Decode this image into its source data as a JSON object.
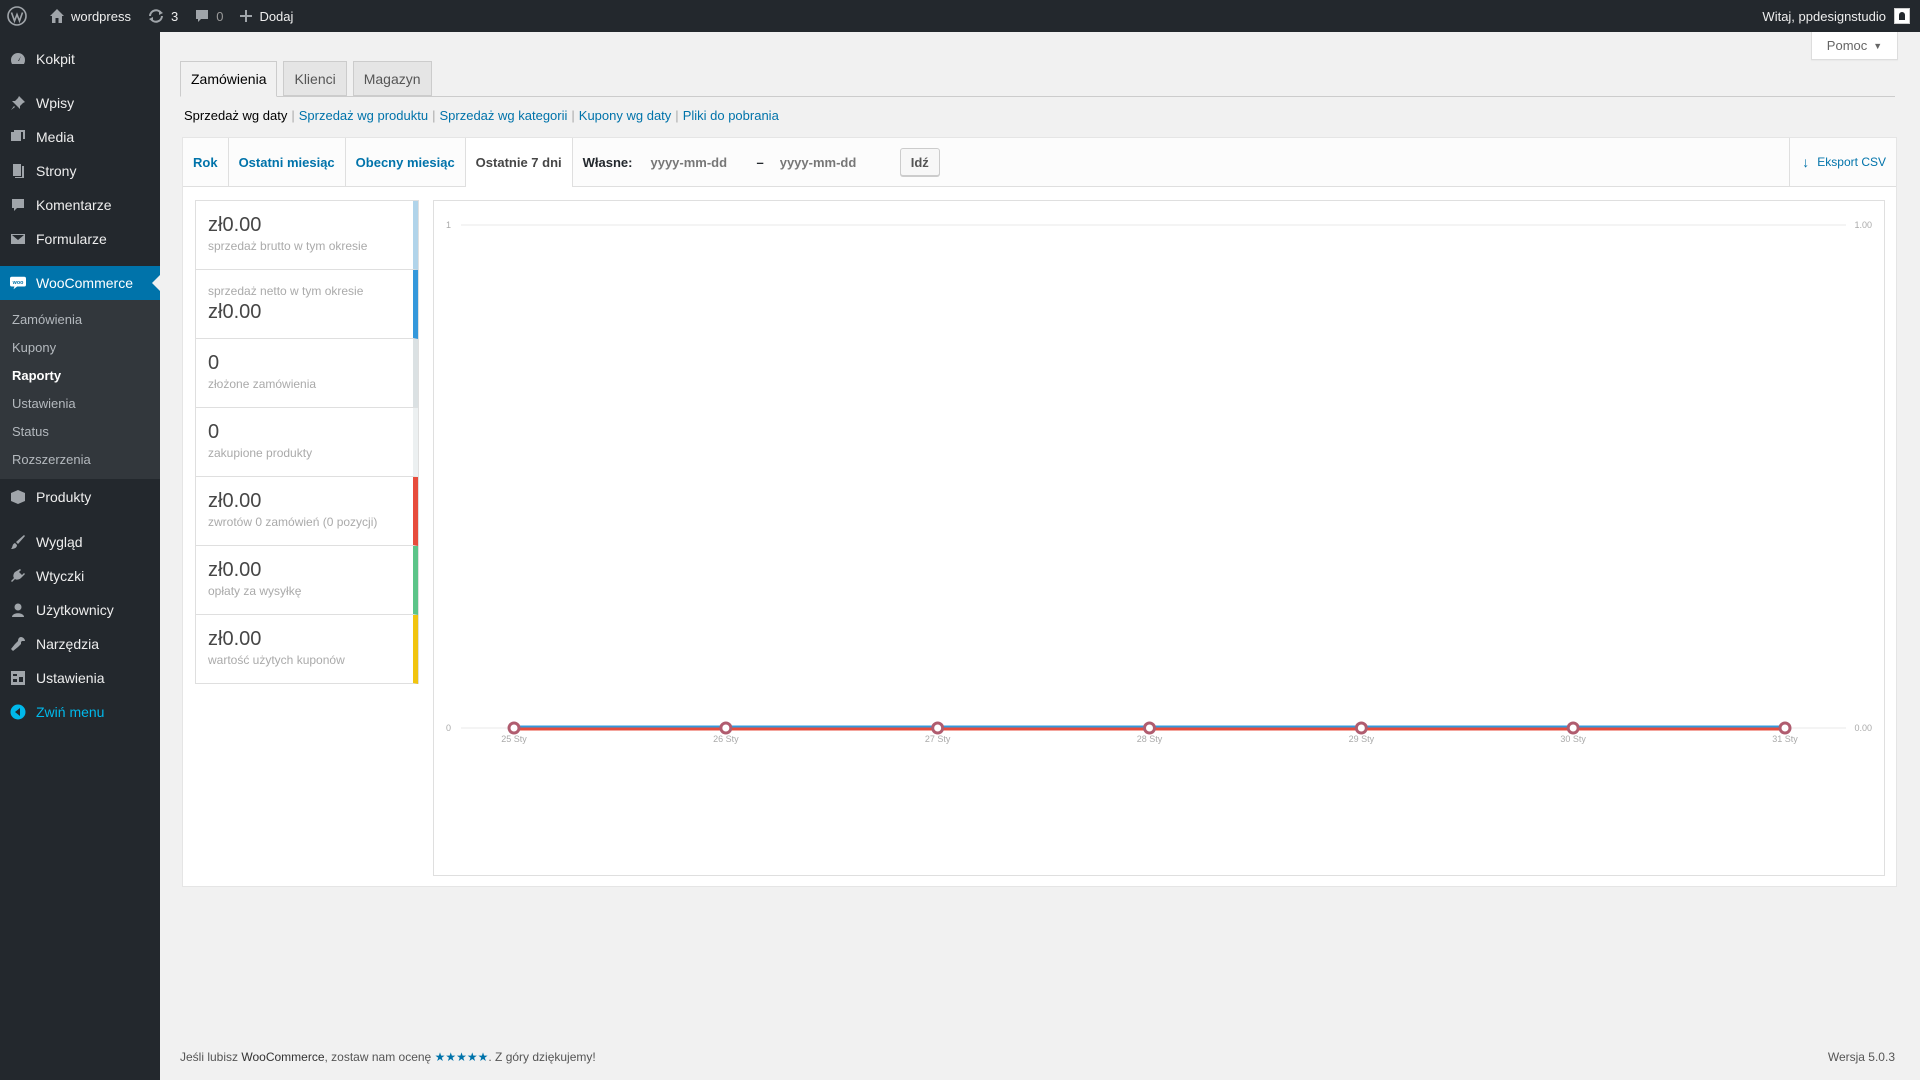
{
  "adminbar": {
    "site_name": "wordpress",
    "updates_count": "3",
    "comments_count": "0",
    "new_label": "Dodaj",
    "greeting": "Witaj, ppdesignstudio"
  },
  "sidebar": {
    "dashboard": "Kokpit",
    "posts": "Wpisy",
    "media": "Media",
    "pages": "Strony",
    "comments": "Komentarze",
    "forms": "Formularze",
    "woocommerce": "WooCommerce",
    "woo_sub": [
      "Zamówienia",
      "Kupony",
      "Raporty",
      "Ustawienia",
      "Status",
      "Rozszerzenia"
    ],
    "products": "Produkty",
    "appearance": "Wygląd",
    "plugins": "Wtyczki",
    "users": "Użytkownicy",
    "tools": "Narzędzia",
    "settings": "Ustawienia",
    "collapse": "Zwiń menu",
    "active_color": "#0073aa"
  },
  "help": {
    "label": "Pomoc"
  },
  "tabs": [
    "Zamówienia",
    "Klienci",
    "Magazyn"
  ],
  "subnav": {
    "current": "Sprzedaż wg daty",
    "links": [
      "Sprzedaż wg produktu",
      "Sprzedaż wg kategorii",
      "Kupony wg daty",
      "Pliki do pobrania"
    ]
  },
  "ranges": {
    "year": "Rok",
    "last_month": "Ostatni miesiąc",
    "this_month": "Obecny miesiąc",
    "last_7": "Ostatnie 7 dni",
    "custom_label": "Własne:",
    "from_placeholder": "yyyy-mm-dd",
    "to_placeholder": "yyyy-mm-dd",
    "dash": "–",
    "go": "Idź",
    "export": "Eksport CSV"
  },
  "legend": [
    {
      "value": "zł0.00",
      "label": "sprzedaż brutto w tym okresie",
      "color": "#b1d4ea"
    },
    {
      "value": "zł0.00",
      "label": "sprzedaż netto w tym okresie",
      "color": "#3498db"
    },
    {
      "value": "0",
      "label": "złożone zamówienia",
      "color": "#dbe1e3"
    },
    {
      "value": "0",
      "label": "zakupione produkty",
      "color": "#ecf0f1"
    },
    {
      "value": "zł0.00",
      "label": "zwrotów 0 zamówień (0 pozycji)",
      "color": "#e74c3c"
    },
    {
      "value": "zł0.00",
      "label": "opłaty za wysyłkę",
      "color": "#5cc488"
    },
    {
      "value": "zł0.00",
      "label": "wartość użytych kuponów",
      "color": "#f1c40f"
    }
  ],
  "chart_data": {
    "type": "line",
    "x": [
      "25 Sty",
      "26 Sty",
      "27 Sty",
      "28 Sty",
      "29 Sty",
      "30 Sty",
      "31 Sty"
    ],
    "series": [
      {
        "values": [
          0,
          0,
          0,
          0,
          0,
          0,
          0
        ],
        "color": "#3498db"
      },
      {
        "values": [
          0,
          0,
          0,
          0,
          0,
          0,
          0
        ],
        "color": "#e74c3c"
      }
    ],
    "left_ticks": [
      "1",
      "0"
    ],
    "right_ticks": [
      "1.00",
      "0.00"
    ],
    "ylim": [
      0,
      1
    ],
    "grid": true
  },
  "footer": {
    "text_before": "Jeśli lubisz ",
    "brand": "WooCommerce",
    "text_mid": ", zostaw nam ocenę ",
    "stars": "★★★★★",
    "text_after": ". Z góry dziękujemy!",
    "version": "Wersja 5.0.3"
  }
}
